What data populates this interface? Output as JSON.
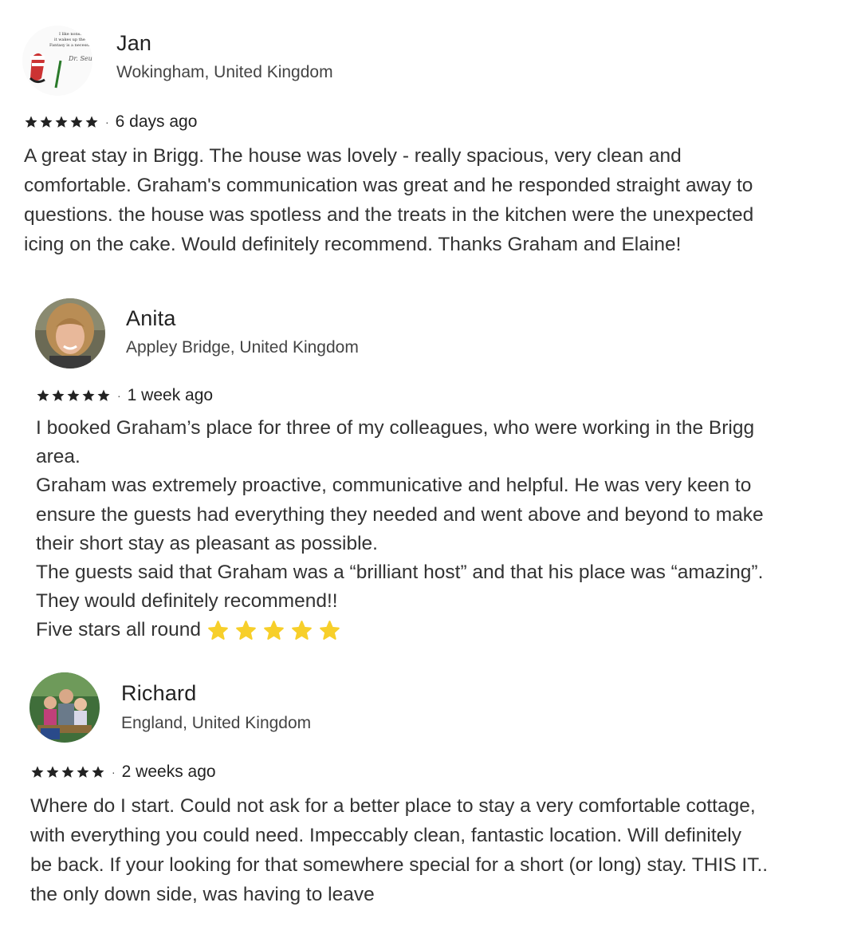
{
  "reviews": [
    {
      "name": "Jan",
      "location": "Wokingham, United Kingdom",
      "rating": 5,
      "date": "6 days ago",
      "text": "A great stay in Brigg. The house was lovely - really spacious, very clean and\ncomfortable. Graham's communication was great and he responded straight away to\nquestions. the house was spotless and the treats in the kitchen were the unexpected\nicing on the cake. Would definitely recommend. Thanks Graham and Elaine!"
    },
    {
      "name": "Anita",
      "location": "Appley Bridge, United Kingdom",
      "rating": 5,
      "date": "1 week ago",
      "text": "I booked Graham’s place for three of my colleagues, who were working in the Brigg\narea.\nGraham was extremely proactive, communicative and helpful. He was very keen to\nensure the guests had everything they needed and went above and beyond to make\ntheir short stay as pleasant as possible.\nThe guests said that Graham was a “brilliant host” and that his place was “amazing”.\nThey would definitely recommend!!\nFive stars all round",
      "emoji_star_count": 5
    },
    {
      "name": "Richard",
      "location": "England, United Kingdom",
      "rating": 5,
      "date": "2 weeks ago",
      "text": "Where do I start. Could not ask for a better place to stay a very comfortable cottage,\nwith everything you could need. Impeccably clean, fantastic location. Will definitely\nbe back. If your looking for that somewhere special for a short (or long) stay. THIS IT..\nthe only down side, was having to leave"
    }
  ],
  "colors": {
    "star": "#222222",
    "emoji_star": "#F7CF2A",
    "text": "#333333"
  }
}
